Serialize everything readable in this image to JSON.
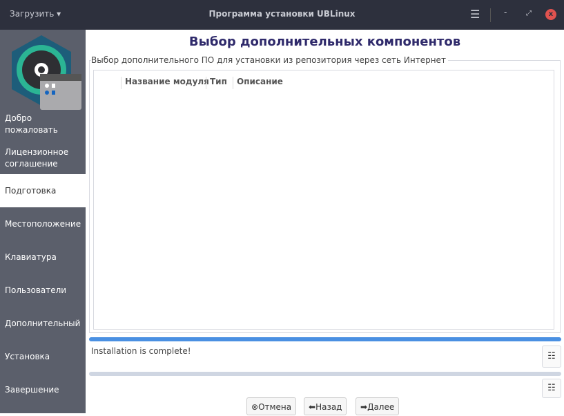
{
  "window": {
    "load_label": "Загрузить",
    "title": "Программа установки UBLinux"
  },
  "sidebar": {
    "items": [
      {
        "label": "Добро пожаловать"
      },
      {
        "label": "Лицензионное соглашение"
      },
      {
        "label": "Подготовка",
        "active": true
      },
      {
        "label": "Местоположение"
      },
      {
        "label": "Клавиатура"
      },
      {
        "label": "Пользователи"
      },
      {
        "label": "Дополнительный"
      },
      {
        "label": "Установка"
      },
      {
        "label": "Завершение"
      }
    ]
  },
  "main": {
    "title": "Выбор дополнительных компонентов",
    "frame_label": "Выбор дополнительного ПО для установки из репозитория через сеть Интернет",
    "columns": [
      "Название модуля",
      "Тип",
      "Описание"
    ]
  },
  "progress": {
    "main": 1.0,
    "secondary": 0,
    "status": "Installation is complete!"
  },
  "buttons": {
    "cancel": "Отмена",
    "back": "Назад",
    "next": "Далее"
  }
}
